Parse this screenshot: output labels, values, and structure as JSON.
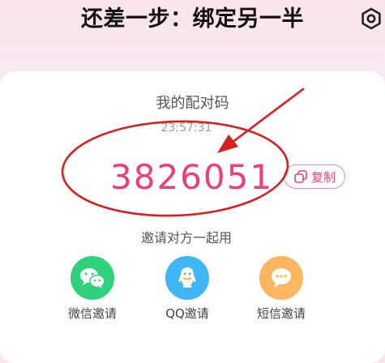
{
  "header": {
    "title": "还差一步：绑定另一半",
    "settings_icon": "settings-hexagon-icon"
  },
  "pairing": {
    "label": "我的配对码",
    "timer": "23:57:31",
    "code": "3826051",
    "copy_label": "复制"
  },
  "invite": {
    "label": "邀请对方一起用",
    "options": [
      {
        "label": "微信邀请",
        "icon": "wechat-icon",
        "color": "#2fd17b"
      },
      {
        "label": "QQ邀请",
        "icon": "qq-icon",
        "color": "#3fb6f5"
      },
      {
        "label": "短信邀请",
        "icon": "sms-icon",
        "color": "#fdb65f"
      }
    ]
  },
  "colors": {
    "accent": "#ef3d78",
    "annotation": "#d81e1e"
  }
}
